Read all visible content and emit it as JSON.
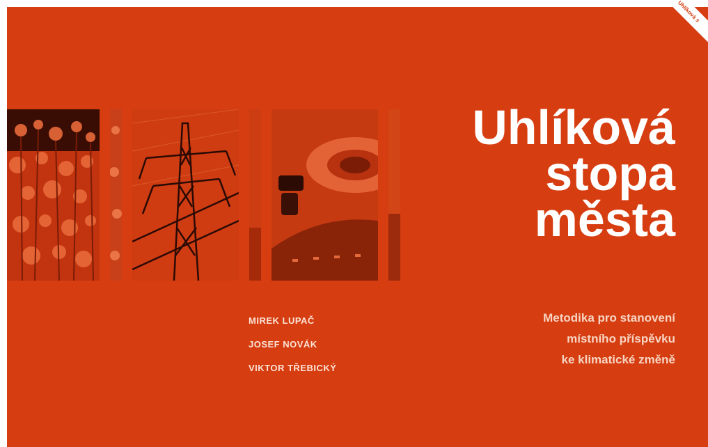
{
  "cover": {
    "background_color": "#d63d10",
    "title_lines": [
      "Uhlíková",
      "stopa",
      "města"
    ],
    "subtitle_lines": [
      "Metodika pro stanovení",
      "místního příspěvku",
      "ke klimatické změně"
    ],
    "authors": [
      "MIREK LUPAČ",
      "JOSEF NOVÁK",
      "VIKTOR TŘEBICKÝ"
    ],
    "corner_ribbon": "Uhlíková s",
    "photo_strips": [
      {
        "subject": "poppy-field-photo"
      },
      {
        "subject": "poppy-field-photo"
      },
      {
        "subject": "power-pylon-photo"
      },
      {
        "subject": "road-roundabout-photo"
      },
      {
        "subject": "road-roundabout-photo"
      },
      {
        "subject": "road-roundabout-photo"
      }
    ]
  }
}
